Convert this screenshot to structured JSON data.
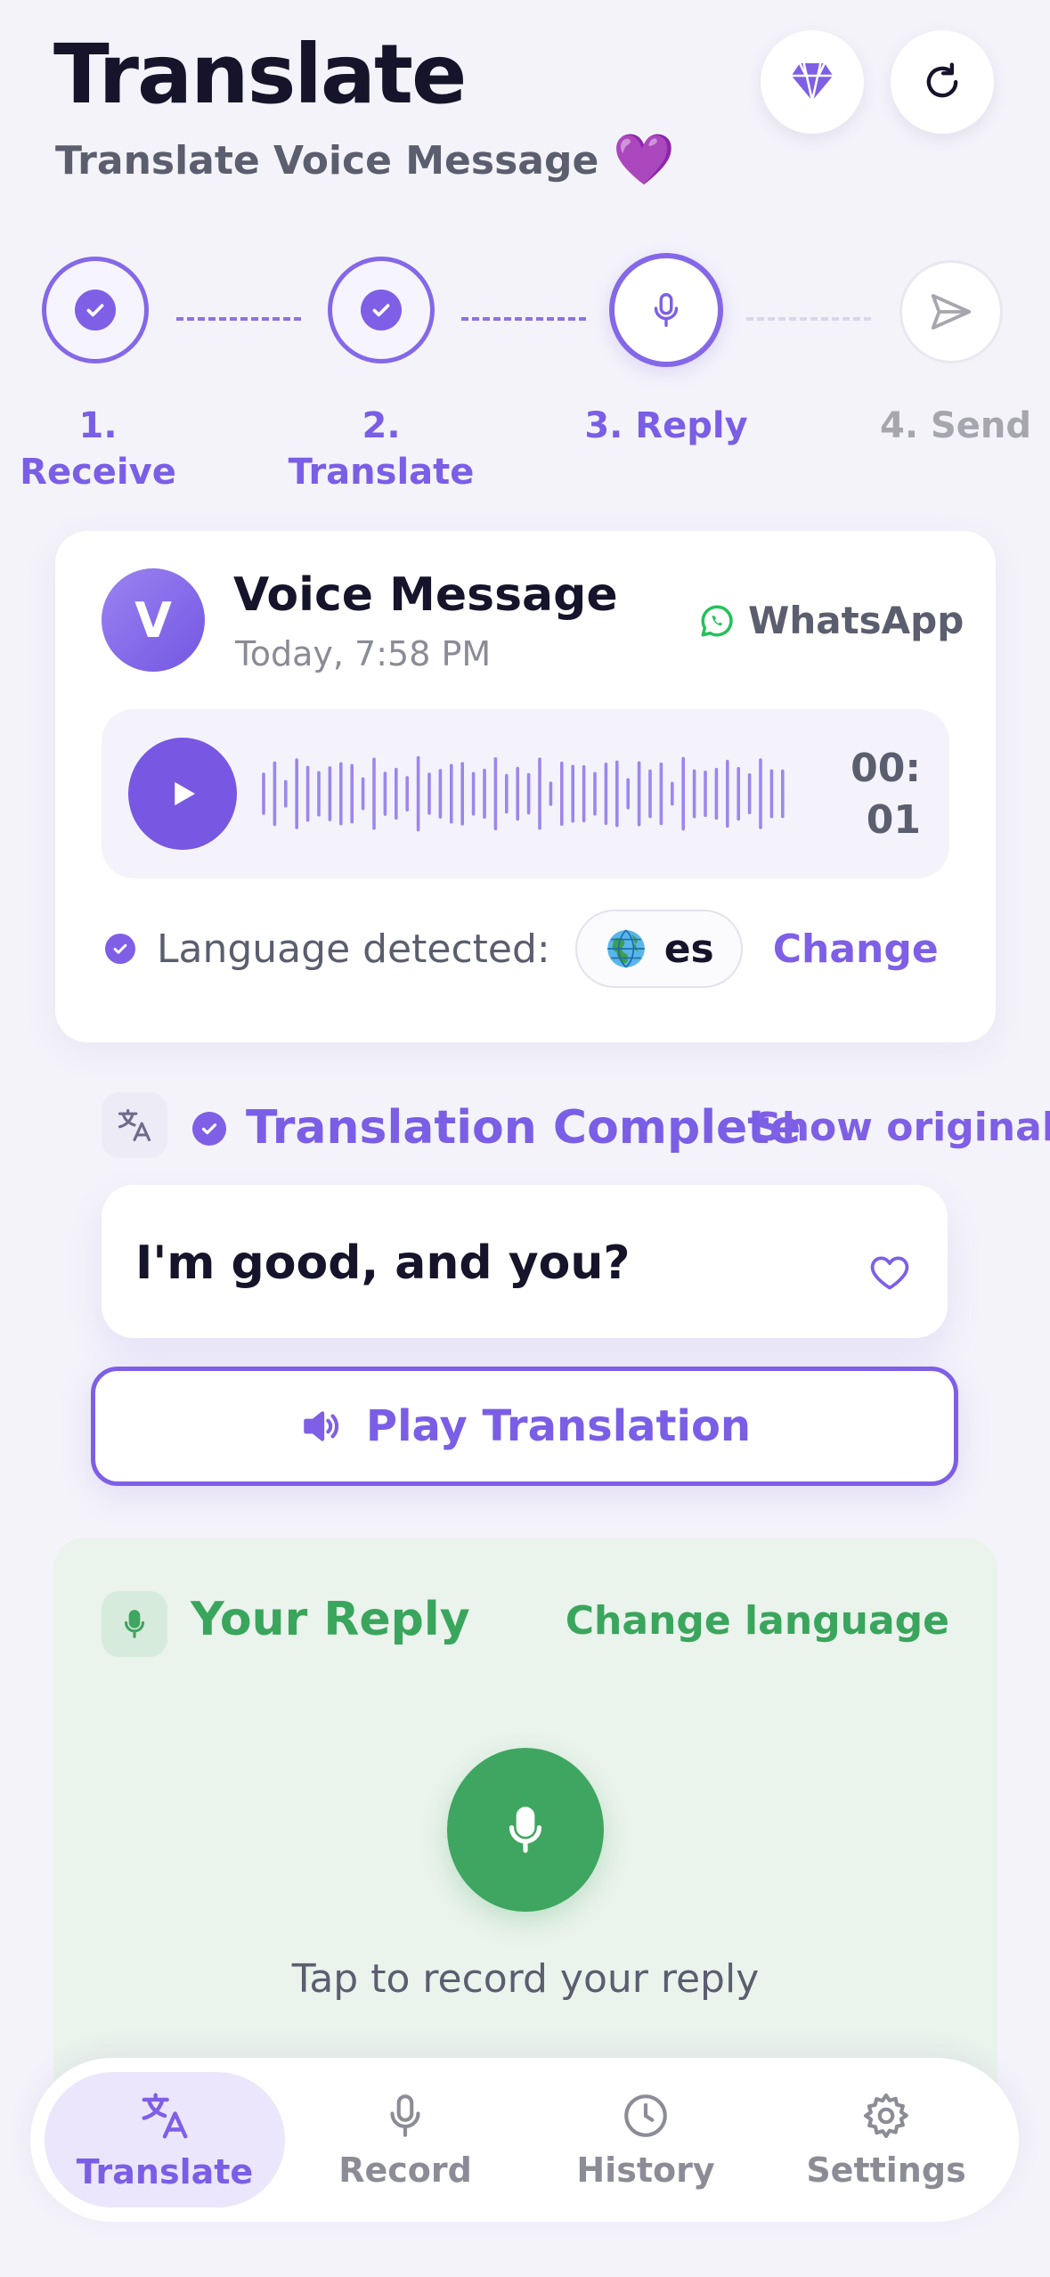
{
  "header": {
    "title": "Translate",
    "subtitle": "Translate Voice Message",
    "subtitle_emoji": "💜",
    "buttons": [
      {
        "name": "premium",
        "icon": "diamond-icon"
      },
      {
        "name": "refresh",
        "icon": "refresh-icon"
      }
    ]
  },
  "stepper": {
    "steps": [
      {
        "number": "1.",
        "label": "Receive",
        "state": "done"
      },
      {
        "number": "2.",
        "label": "Translate",
        "state": "done"
      },
      {
        "number": "",
        "label": "3. Reply",
        "state": "current"
      },
      {
        "number": "",
        "label": "4. Send",
        "state": "pending"
      }
    ]
  },
  "voice_card": {
    "avatar_letter": "V",
    "title": "Voice Message",
    "timestamp": "Today, 7:58 PM",
    "platform": "WhatsApp",
    "duration": "00:01",
    "language_label": "Language detected:",
    "language_code": "es",
    "change_label": "Change"
  },
  "translation": {
    "title": "Translation Complete",
    "show_original": "Show original",
    "text": "I'm good, and you?",
    "play_label": "Play Translation"
  },
  "reply": {
    "title": "Your Reply",
    "change_language": "Change language",
    "hint": "Tap to record your reply"
  },
  "bottom_nav": {
    "items": [
      {
        "label": "Translate",
        "icon": "translate-icon",
        "active": true
      },
      {
        "label": "Record",
        "icon": "mic-icon",
        "active": false
      },
      {
        "label": "History",
        "icon": "clock-icon",
        "active": false
      },
      {
        "label": "Settings",
        "icon": "gear-icon",
        "active": false
      }
    ]
  },
  "colors": {
    "accent": "#7e5fe6",
    "reply_green": "#3ea660",
    "background": "#f4f3fa"
  }
}
